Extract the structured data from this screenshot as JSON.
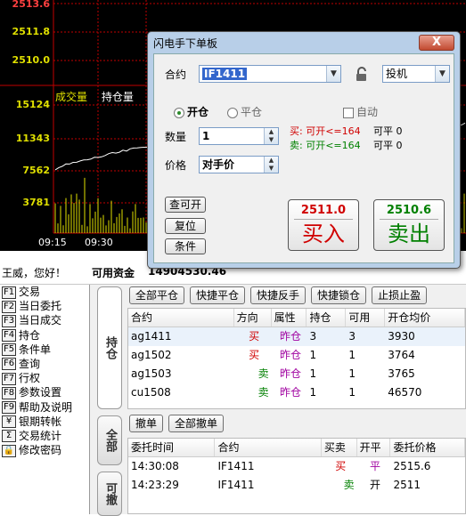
{
  "chart": {
    "price_labels": [
      "2513.6",
      "2511.8",
      "2510.0"
    ],
    "vol_header": [
      "成交量",
      "持仓量"
    ],
    "vol_labels": [
      "15124",
      "11343",
      "7562",
      "3781"
    ],
    "time_labels": [
      "09:15",
      "09:30"
    ]
  },
  "status": {
    "greeting": "王威，您好！",
    "capital_label": "可用资金",
    "capital_value": "14904530.46"
  },
  "menu": [
    {
      "key": "F1",
      "label": "交易"
    },
    {
      "key": "F2",
      "label": "当日委托"
    },
    {
      "key": "F3",
      "label": "当日成交"
    },
    {
      "key": "F4",
      "label": "持仓"
    },
    {
      "key": "F5",
      "label": "条件单"
    },
    {
      "key": "F6",
      "label": "查询"
    },
    {
      "key": "F7",
      "label": "行权"
    },
    {
      "key": "F8",
      "label": "参数设置"
    },
    {
      "key": "F9",
      "label": "帮助及说明"
    },
    {
      "key": "¥",
      "label": "银期转帐"
    },
    {
      "key": "Σ",
      "label": "交易统计"
    },
    {
      "key": "🔒",
      "label": "修改密码"
    }
  ],
  "vtabs": {
    "positions": "持仓",
    "all": "全部",
    "cancelable": "可撤"
  },
  "positions": {
    "buttons": [
      "全部平仓",
      "快捷平仓",
      "快捷反手",
      "快捷锁仓",
      "止损止盈"
    ],
    "headers": [
      "合约",
      "方向",
      "属性",
      "持仓",
      "可用",
      "开仓均价"
    ],
    "rows": [
      {
        "contract": "ag1411",
        "dir": "买",
        "attr": "昨仓",
        "pos": "3",
        "avail": "3",
        "avg": "3930"
      },
      {
        "contract": "ag1502",
        "dir": "买",
        "attr": "昨仓",
        "pos": "1",
        "avail": "1",
        "avg": "3764"
      },
      {
        "contract": "ag1503",
        "dir": "卖",
        "attr": "昨仓",
        "pos": "1",
        "avail": "1",
        "avg": "3765"
      },
      {
        "contract": "cu1508",
        "dir": "卖",
        "attr": "昨仓",
        "pos": "1",
        "avail": "1",
        "avg": "46570"
      }
    ]
  },
  "orders": {
    "buttons": [
      "撤单",
      "全部撤单"
    ],
    "headers": [
      "委托时间",
      "合约",
      "买卖",
      "开平",
      "委托价格"
    ],
    "rows": [
      {
        "time": "14:30:08",
        "contract": "IF1411",
        "side": "买",
        "oc": "平",
        "price": "2515.6"
      },
      {
        "time": "14:23:29",
        "contract": "IF1411",
        "side": "卖",
        "oc": "开",
        "price": "2511"
      }
    ]
  },
  "dialog": {
    "title": "闪电手下单板",
    "close": "X",
    "contract_label": "合约",
    "contract_value": "IF1411",
    "type_value": "投机",
    "open_label": "开仓",
    "close_label": "平仓",
    "auto_label": "自动",
    "qty_label": "数量",
    "qty_value": "1",
    "price_label": "价格",
    "price_value": "对手价",
    "buy_info": "买: 可开<=164",
    "buy_close": "可平 0",
    "sell_info": "卖: 可开<=164",
    "sell_close": "可平 0",
    "btn_query": "查可开",
    "btn_reset": "复位",
    "btn_cond": "条件",
    "buy_price": "2511.0",
    "buy_action": "买入",
    "sell_price": "2510.6",
    "sell_action": "卖出"
  }
}
